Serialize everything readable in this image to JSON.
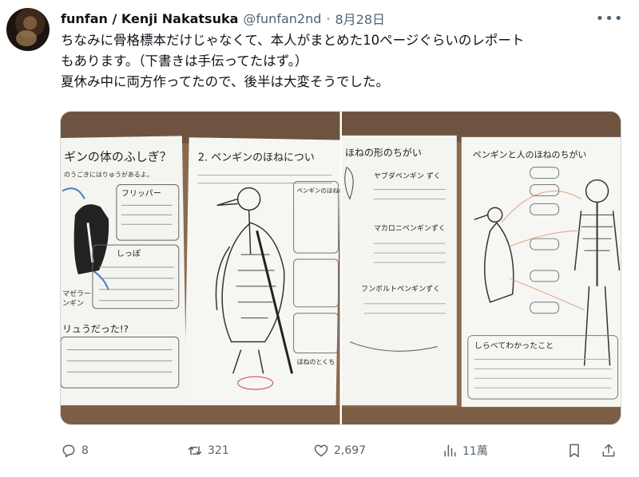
{
  "author": {
    "display_name": "funfan / Kenji Nakatsuka",
    "handle": "@funfan2nd",
    "separator": "·",
    "date": "8月28日"
  },
  "tweet": {
    "lines": [
      "ちなみに骨格標本だけじゃなくて、本人がまとめた10ページぐらいのレポート",
      "もあります。（下書きは手伝ってたはず。）",
      "夏休み中に両方作ってたので、後半は大変そうでした。"
    ]
  },
  "media": {
    "photo1": {
      "page_left": {
        "title": "ギンの体のふしぎ？",
        "subtitle": "のうごきにはりゅうがあるよ。",
        "box1_title": "フリッパー",
        "box2_title": "しっぽ",
        "side_labels": [
          "マゼラー",
          "ンギン"
        ],
        "box3_title": "リュうだった!?"
      },
      "page_right": {
        "title": "2. ペンギンのほねについ",
        "box1_title": "ペンギンのほねのとく",
        "box2_title": "ほねのとくち"
      }
    },
    "photo2": {
      "page_left": {
        "title": "ほねの形のちがい",
        "label1": "ヤブダペンギン ずく",
        "label2": "マカロニペンギンずく",
        "label3": "フンボルトペンギンずく"
      },
      "page_right": {
        "title": "ペンギンと人のほねのちがい",
        "box_title": "しらべてわかったこと"
      }
    }
  },
  "stats": {
    "replies": "8",
    "retweets": "321",
    "likes": "2,697",
    "views": "11萬"
  },
  "icons": [
    "more-icon",
    "reply-icon",
    "retweet-icon",
    "like-icon",
    "views-icon",
    "bookmark-icon",
    "share-icon"
  ]
}
